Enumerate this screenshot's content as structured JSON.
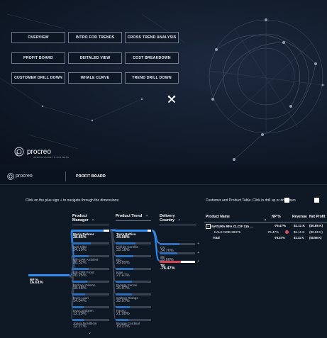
{
  "nav": {
    "buttons": [
      {
        "label": "OVERVIEW"
      },
      {
        "label": "INTRO FOR TRENDS"
      },
      {
        "label": "CROSS TREND ANALYSIS"
      },
      {
        "label": "PROFIT BOARD"
      },
      {
        "label": "DEITALED VIEW"
      },
      {
        "label": "COST BREAKDOWN"
      },
      {
        "label": "CUSTOMER DRILL DOWN"
      },
      {
        "label": "WHALE CURVE"
      },
      {
        "label": "TREND DRILL DOWN"
      }
    ],
    "tools_icon": "wrench-screwdriver-icon"
  },
  "logo": {
    "word": "procreo",
    "tagline": "ADDING VALUE TO BUSINESS"
  },
  "report": {
    "brand": "procreo",
    "title": "PROFIT BOARD",
    "instruction_left": "Click on the plus sign  +  to navigate through the dimensions:",
    "instruction_right": "Customer and Product Table. Click in drill up      or drill down",
    "tree": {
      "root": {
        "label": "NP %",
        "value": "16.61%"
      },
      "columns": [
        {
          "header": "Product Manager",
          "close": "×"
        },
        {
          "header": "Product Trend",
          "close": "×"
        },
        {
          "header": "Delivery Country",
          "close": "×"
        }
      ],
      "manager": [
        {
          "label": "Mario Rebnor",
          "value": "28.85%",
          "fill": 0.85
        },
        {
          "label": "Sari Nikki",
          "value": "24.10%",
          "fill": 0.5
        },
        {
          "label": "Ulli-CPR Ambient",
          "value": "20.52%",
          "fill": 0.45
        },
        {
          "label": "Ulli-CPR Frost",
          "value": "20.25%",
          "fill": 0.45
        },
        {
          "label": "Michael Olsson",
          "value": "18.48%",
          "fill": 0.4
        },
        {
          "label": "Even Lauri",
          "value": "14.04%",
          "fill": 0.35
        },
        {
          "label": "Eva Lundgren",
          "value": "12.29%",
          "fill": 0.3
        },
        {
          "label": "Joana Nordblom",
          "value": "12.17%",
          "fill": 0.3
        }
      ],
      "trend": [
        {
          "label": "Terra Baltica",
          "value": "34.08%",
          "fill": 0.9
        },
        {
          "label": "Poll de Corellio",
          "value": "33.18%",
          "fill": 0.55
        },
        {
          "label": "BIC",
          "value": "28.89%",
          "fill": 0.5
        },
        {
          "label": "Kale",
          "value": "27.47%",
          "fill": 0.5
        },
        {
          "label": "Rioage Ferrari",
          "value": "26.97%",
          "fill": 0.45
        },
        {
          "label": "Carbon Rioage",
          "value": "25.97%",
          "fill": 0.45
        },
        {
          "label": "Fasno",
          "value": "21.08%",
          "fill": 0.4
        },
        {
          "label": "Rioage Cardinal",
          "value": "19.21%",
          "fill": 0.35
        }
      ],
      "country": [
        {
          "label": "CN",
          "value": "34.76%",
          "fill": 0.55
        },
        {
          "label": "SE",
          "value": "33.66%",
          "fill": 0.5
        },
        {
          "label": "TR",
          "value": "-76.47%",
          "fill": 0.6
        }
      ]
    },
    "table": {
      "headers": [
        "Product Name",
        "NP %",
        "Revenue",
        "Net Profit"
      ],
      "rows": [
        {
          "name": "NATURA RFA CLC/F 115 ...",
          "np": "-76.47%",
          "rev": "$1.11 K",
          "profit": "($0.85 K)"
        },
        {
          "name": "KALE NOB 29375",
          "np": "-76.47%",
          "rev": "$1.11 K",
          "profit": "($0.85 K)"
        },
        {
          "name": "Total",
          "np": "-76.47%",
          "rev": "$1.11 K",
          "profit": "($0.85 K)"
        }
      ]
    }
  }
}
